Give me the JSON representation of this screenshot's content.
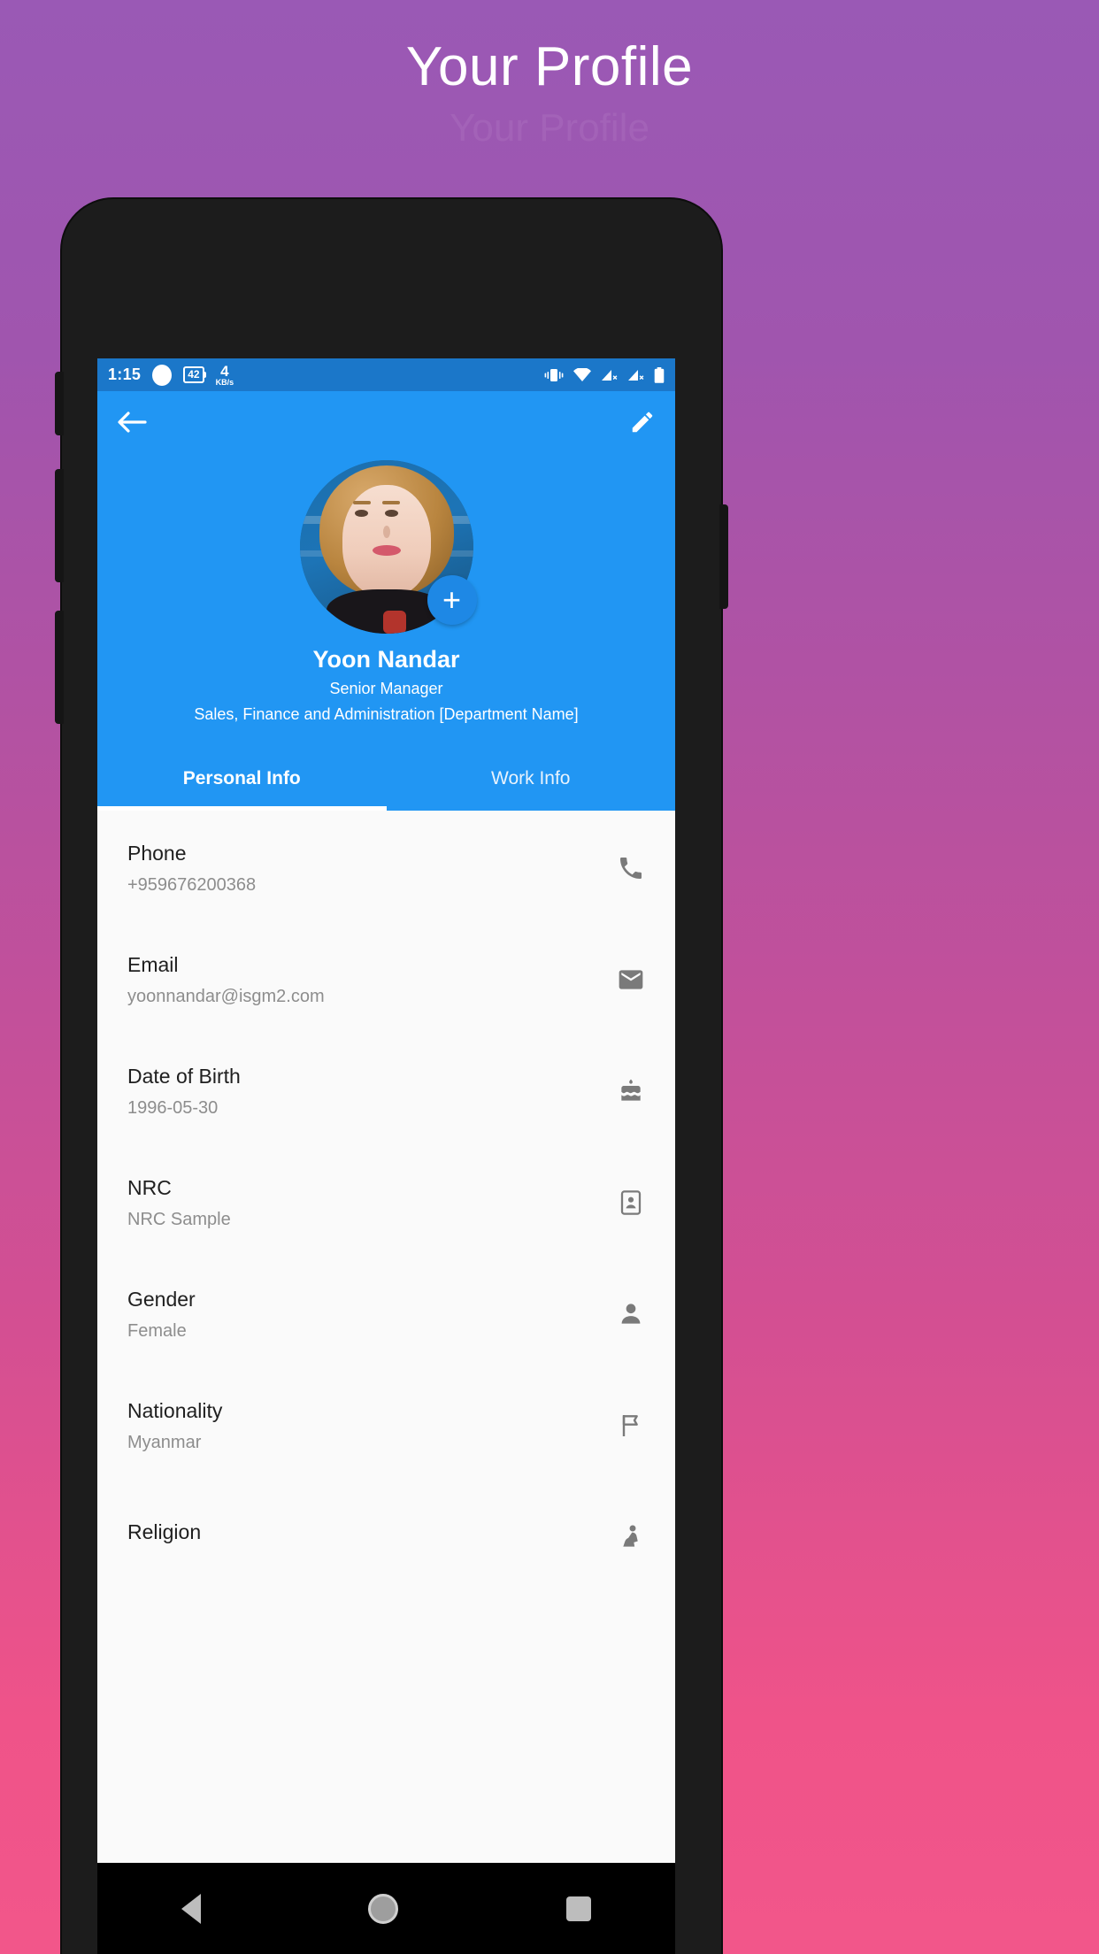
{
  "page": {
    "title": "Your Profile",
    "ghost_text": "Your Profile"
  },
  "colors": {
    "header_blue": "#2196f3",
    "status_blue": "#1b77c9",
    "gradient_top": "#9a59b5",
    "gradient_bottom": "#ef5389",
    "fab_blue": "#1e88e5",
    "icon_grey": "#7a7a7a"
  },
  "statusbar": {
    "clock": "1:15",
    "battery_badge": "42",
    "net_speed_value": "4",
    "net_speed_unit": "KB/s",
    "icons": [
      "vibrate-icon",
      "wifi-icon",
      "signal-off-icon",
      "signal-off-icon",
      "battery-icon"
    ]
  },
  "appbar": {
    "back_icon": "back-arrow-icon",
    "edit_icon": "pencil-edit-icon"
  },
  "profile": {
    "avatar_alt": "profile-photo",
    "add_photo_label": "+",
    "name": "Yoon Nandar",
    "role": "Senior Manager",
    "department": "Sales, Finance and Administration [Department Name]"
  },
  "tabs": [
    {
      "label": "Personal Info",
      "active": true
    },
    {
      "label": "Work Info",
      "active": false
    }
  ],
  "info_rows": [
    {
      "label": "Phone",
      "value": "+959676200368",
      "icon": "phone-icon"
    },
    {
      "label": "Email",
      "value": "yoonnandar@isgm2.com",
      "icon": "email-icon"
    },
    {
      "label": "Date of Birth",
      "value": "1996-05-30",
      "icon": "cake-icon"
    },
    {
      "label": "NRC",
      "value": "NRC Sample",
      "icon": "id-card-icon"
    },
    {
      "label": "Gender",
      "value": "Female",
      "icon": "person-icon"
    },
    {
      "label": "Nationality",
      "value": "Myanmar",
      "icon": "flag-icon"
    },
    {
      "label": "Religion",
      "value": "",
      "icon": "praying-person-icon"
    }
  ],
  "navbar": {
    "back": "nav-back-icon",
    "home": "nav-home-icon",
    "recents": "nav-recents-icon"
  }
}
